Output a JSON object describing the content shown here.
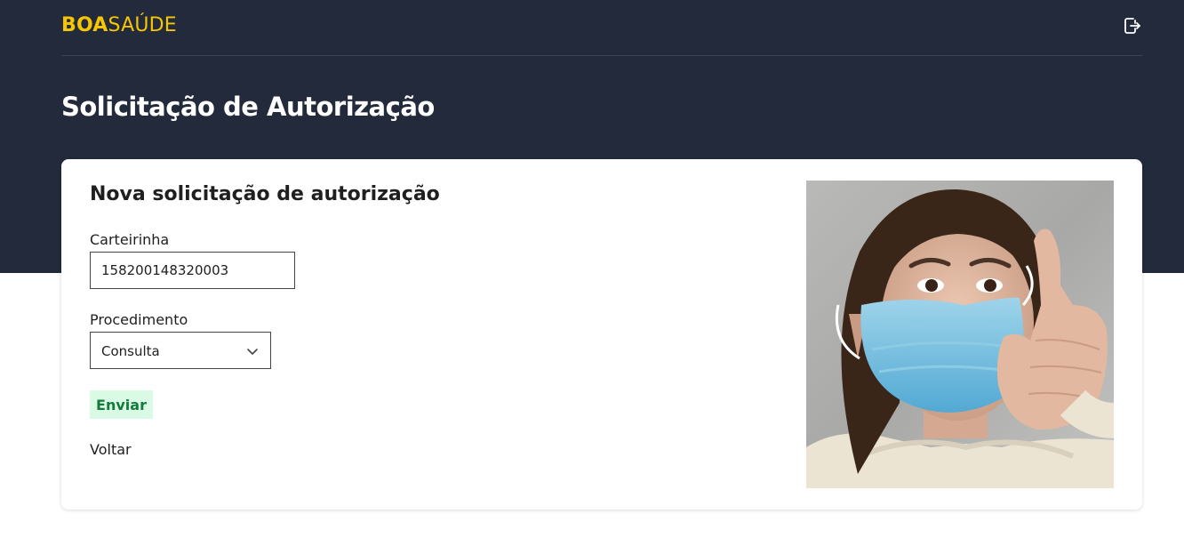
{
  "brand": {
    "logo_bold": "BOA",
    "logo_regular": "SAÚDE",
    "color": "#f6c602"
  },
  "header": {
    "logout_icon": "logout-icon"
  },
  "page": {
    "title": "Solicitação de Autorização"
  },
  "form": {
    "title": "Nova solicitação de autorização",
    "card_number": {
      "label": "Carteirinha",
      "value": "158200148320003"
    },
    "procedure": {
      "label": "Procedimento",
      "selected": "Consulta"
    },
    "submit_label": "Enviar",
    "back_label": "Voltar"
  },
  "image": {
    "subject": "woman-face-mask-thumbs-up-photo"
  },
  "colors": {
    "hero_bg": "#222a3b",
    "submit_bg": "#d9fbe5",
    "submit_text": "#157a3a"
  }
}
